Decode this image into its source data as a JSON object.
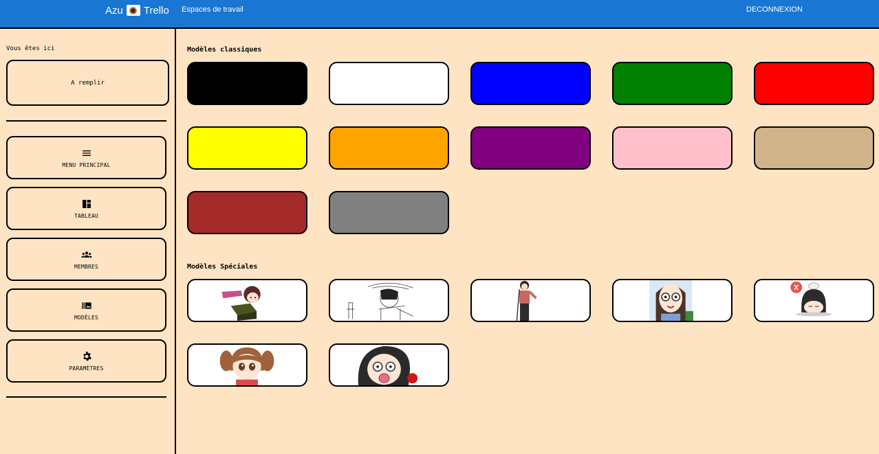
{
  "header": {
    "brand_left": "Azu",
    "brand_right": "Trello",
    "workspaces_link": "Espaces de travail",
    "logout_link": "DECONNEXION",
    "bar_color": "#1976d2"
  },
  "sidebar": {
    "location_label": "Vous êtes ici",
    "location_value": "A remplir",
    "items": [
      {
        "label": "MENU PRINCIPAL",
        "icon": "menu-icon"
      },
      {
        "label": "TABLEAU",
        "icon": "dashboard-icon"
      },
      {
        "label": "MEMBRES",
        "icon": "groups-icon"
      },
      {
        "label": "MODÈLES",
        "icon": "photo-library-icon"
      },
      {
        "label": "PARAMÈTRES",
        "icon": "settings-gear-icon"
      }
    ]
  },
  "classic_templates": {
    "title": "Modèles classiques",
    "colors": [
      "#000000",
      "#ffffff",
      "#0000ff",
      "#008000",
      "#ff0000",
      "#ffff00",
      "#ffa500",
      "#800080",
      "#ffc0cb",
      "#d2b48c",
      "#a52a2a",
      "#808080"
    ]
  },
  "special_templates": {
    "title": "Modèles Spéciales",
    "images": [
      "anime-character-lying-on-box-image",
      "sketched-character-with-hat-image",
      "character-standing-in-doorway-image",
      "character-with-glasses-image",
      "sleepy-character-with-cat-image",
      "character-with-pigtails-image",
      "surprised-character-image"
    ]
  }
}
